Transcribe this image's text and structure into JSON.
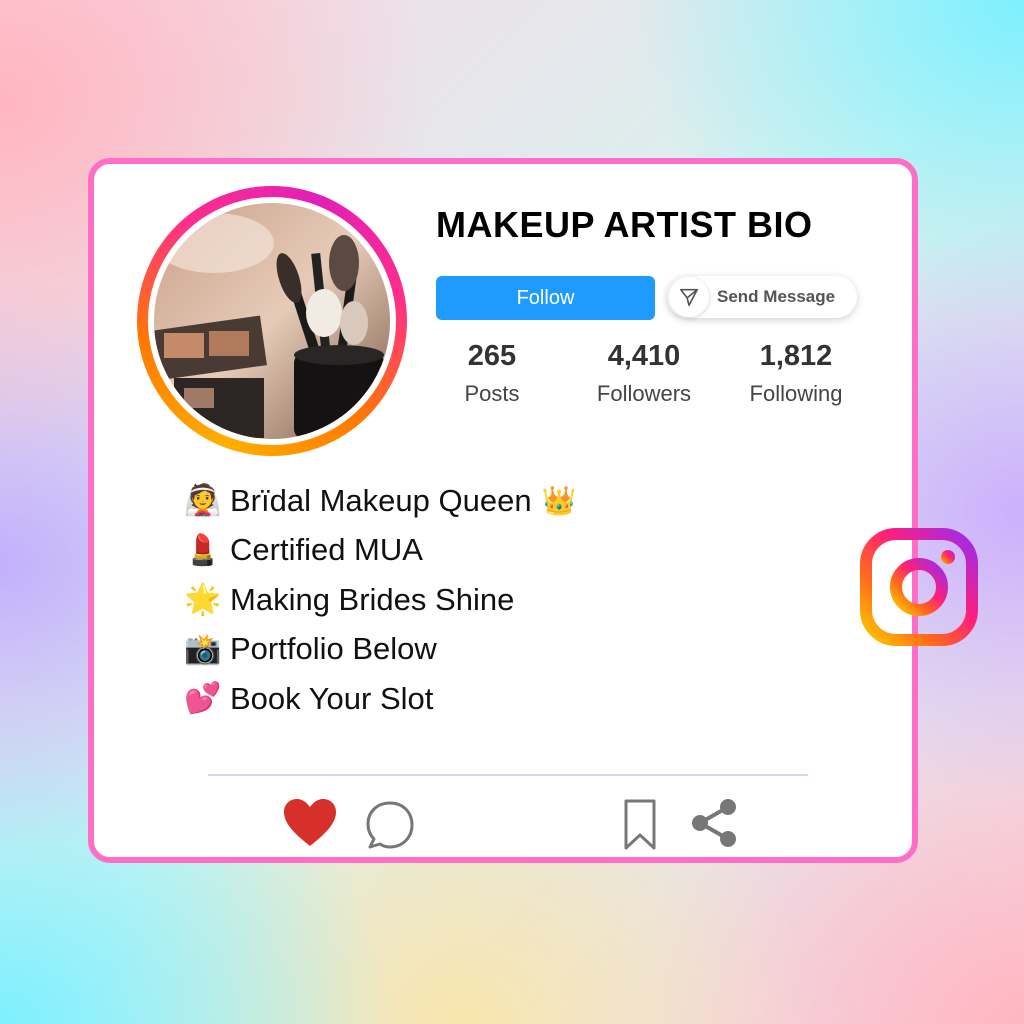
{
  "header": {
    "title": "MAKEUP ARTIST BIO"
  },
  "buttons": {
    "follow": "Follow",
    "send_message": "Send Message"
  },
  "stats": [
    {
      "value": "265",
      "label": "Posts"
    },
    {
      "value": "4,410",
      "label": "Followers"
    },
    {
      "value": "1,812",
      "label": "Following"
    }
  ],
  "bio": [
    {
      "emoji": "👰",
      "text": "Brïdal Makeup Queen",
      "trail": "👑"
    },
    {
      "emoji": "💄",
      "text": "Certified MUA"
    },
    {
      "emoji": "🌟",
      "text": "Making Brides Shine"
    },
    {
      "emoji": "📸",
      "text": "Portfolio Below"
    },
    {
      "emoji": "💕",
      "text": "Book Your Slot"
    }
  ],
  "icons": {
    "like": "heart-icon",
    "comment": "comment-icon",
    "save": "bookmark-icon",
    "share": "share-icon",
    "send": "paper-plane-icon",
    "brand": "instagram-icon"
  },
  "colors": {
    "card_border": "#ff6ec6",
    "follow_button": "#1f9bff",
    "heart": "#d7302b"
  }
}
